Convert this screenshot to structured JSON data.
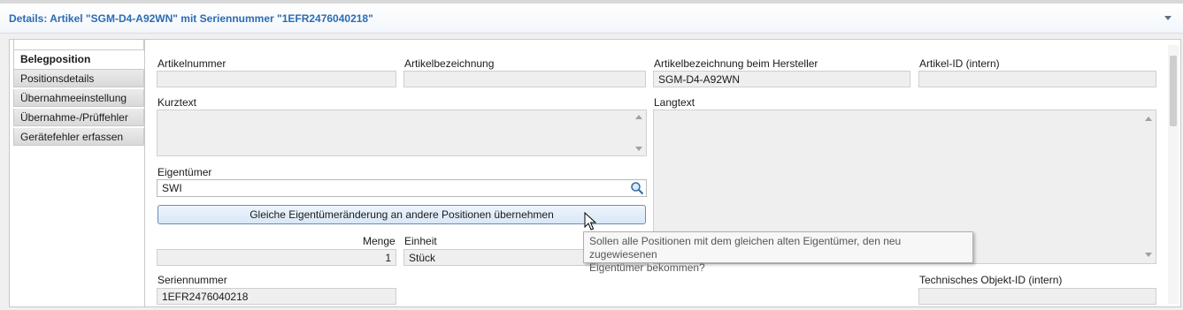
{
  "header": {
    "title": "Details: Artikel \"SGM-D4-A92WN\" mit Seriennummer \"1EFR2476040218\""
  },
  "tabs": [
    {
      "label": "Belegposition",
      "active": true
    },
    {
      "label": "Positionsdetails"
    },
    {
      "label": "Übernahmeeinstellung"
    },
    {
      "label": "Übernahme-/Prüffehler"
    },
    {
      "label": "Gerätefehler erfassen"
    }
  ],
  "form": {
    "artikelnummer": {
      "label": "Artikelnummer",
      "value": ""
    },
    "artikelbezeichnung": {
      "label": "Artikelbezeichnung",
      "value": ""
    },
    "artikelbezeichnung_hersteller": {
      "label": "Artikelbezeichnung beim Hersteller",
      "value": "SGM-D4-A92WN"
    },
    "artikel_id": {
      "label": "Artikel-ID (intern)",
      "value": ""
    },
    "kurztext": {
      "label": "Kurztext",
      "value": ""
    },
    "langtext": {
      "label": "Langtext",
      "value": ""
    },
    "eigentuemer": {
      "label": "Eigentümer",
      "value": "SWI"
    },
    "uebernehmen_button": "Gleiche Eigentümeränderung an andere Positionen übernehmen",
    "menge": {
      "label": "Menge",
      "value": "1"
    },
    "einheit": {
      "label": "Einheit",
      "value": "Stück"
    },
    "seriennummer": {
      "label": "Seriennummer",
      "value": "1EFR2476040218"
    },
    "technisches_objekt_id": {
      "label": "Technisches Objekt-ID (intern)",
      "value": ""
    }
  },
  "tooltip": {
    "line1": "Sollen alle Positionen mit dem gleichen alten Eigentümer, den neu zugewiesenen",
    "line2": "Eigentümer bekommen?"
  },
  "colors": {
    "accent": "#2b6cb3",
    "field_bg": "#efefef",
    "button_border": "#6b8fba"
  }
}
